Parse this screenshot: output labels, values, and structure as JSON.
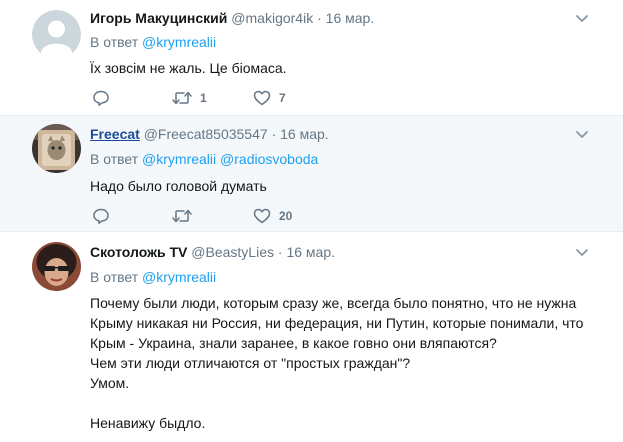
{
  "tweets": [
    {
      "name": "Игорь Макуцинский",
      "handle": "@makigor4ik",
      "dot": "·",
      "time": "16 мар.",
      "reply_prefix": "В ответ",
      "mentions": [
        "@krymrealii"
      ],
      "text": "Їх зовсім не жаль. Це біомаса.",
      "replies": "",
      "retweets": "1",
      "likes": "7"
    },
    {
      "name": "Freecat",
      "handle": "@Freecat85035547",
      "dot": "·",
      "time": "16 мар.",
      "reply_prefix": "В ответ",
      "mentions": [
        "@krymrealii",
        "@radiosvoboda"
      ],
      "text": "Надо было головой думать",
      "replies": "",
      "retweets": "",
      "likes": "20"
    },
    {
      "name": "Скотоложь TV",
      "handle": "@BeastyLies",
      "dot": "·",
      "time": "16 мар.",
      "reply_prefix": "В ответ",
      "mentions": [
        "@krymrealii"
      ],
      "text": "Почему были люди, которым сразу же, всегда было понятно, что не нужна\nКрыму никакая ни Россия, ни федерация, ни Путин, которые понимали, что\nКрым - Украина, знали заранее, в какое говно они вляпаются?\nЧем эти люди отличаются от \"простых граждан\"?\nУмом.\n\nНенавижу быдло."
    }
  ],
  "colors": {
    "accent": "#1da1f2",
    "muted": "#657786",
    "highlight_bg": "#f5f8fa",
    "divider": "#e6ecf0"
  },
  "icons": [
    "reply-icon",
    "retweet-icon",
    "like-icon",
    "caret-down-icon"
  ]
}
